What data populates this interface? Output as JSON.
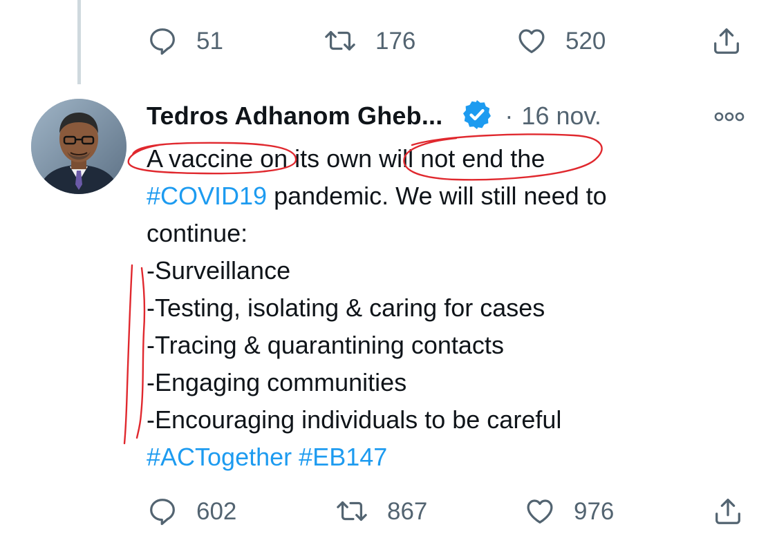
{
  "previous_tweet": {
    "actions": {
      "replies": "51",
      "retweets": "176",
      "likes": "520"
    }
  },
  "tweet": {
    "author_name": "Tedros Adhanom Gheb...",
    "separator": "·",
    "date": "16 nov.",
    "verified": true,
    "body": {
      "line1": "A vaccine on its own will not end the",
      "line2_hashtag": "#COVID19",
      "line2_rest": " pandemic. We will still need to",
      "line3": "continue:",
      "list": [
        "-Surveillance",
        "-Testing, isolating & caring for cases",
        "-Tracing & quarantining contacts",
        "-Engaging communities",
        "-Encouraging individuals to be careful"
      ],
      "hashtag1": "#ACTogether",
      "hashtag2": "#EB147"
    },
    "actions": {
      "replies": "602",
      "retweets": "867",
      "likes": "976"
    }
  },
  "icons": {
    "reply": "speech-bubble-icon",
    "retweet": "retweet-arrows-icon",
    "like": "heart-icon",
    "share": "share-upload-icon",
    "more": "more-options-icon",
    "verified": "verified-badge-icon"
  },
  "colors": {
    "text": "#0f1419",
    "muted": "#536471",
    "hashtag": "#1d9bf0",
    "verified_badge": "#1d9bf0",
    "annotation": "#e0282e",
    "thread_line": "#cfd9de"
  }
}
